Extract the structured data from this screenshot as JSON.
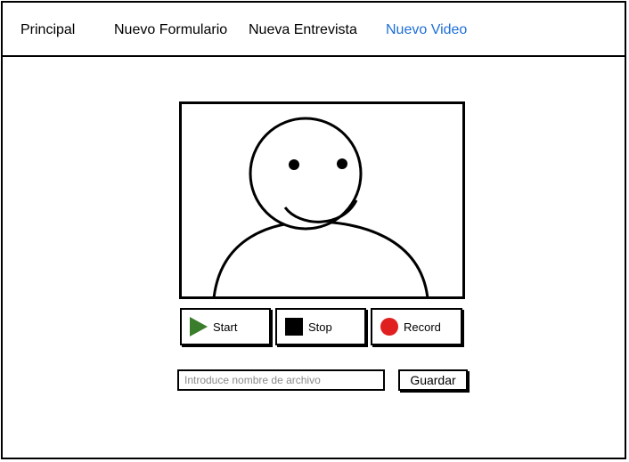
{
  "nav": {
    "items": [
      {
        "label": "Principal"
      },
      {
        "label": "Nuevo Formulario"
      },
      {
        "label": "Nueva Entrevista"
      },
      {
        "label": "Nuevo Video",
        "active": true
      }
    ],
    "active_color": "#1f6fd6"
  },
  "video": {
    "placeholder_icon": "smiley-person-icon"
  },
  "controls": {
    "start_label": "Start",
    "stop_label": "Stop",
    "record_label": "Record",
    "start_icon": "play-icon",
    "stop_icon": "stop-icon",
    "record_icon": "record-icon",
    "play_color": "#3a7d2a",
    "record_color": "#e02020"
  },
  "save": {
    "placeholder": "Introduce nombre de archivo",
    "value": "",
    "button_label": "Guardar"
  }
}
